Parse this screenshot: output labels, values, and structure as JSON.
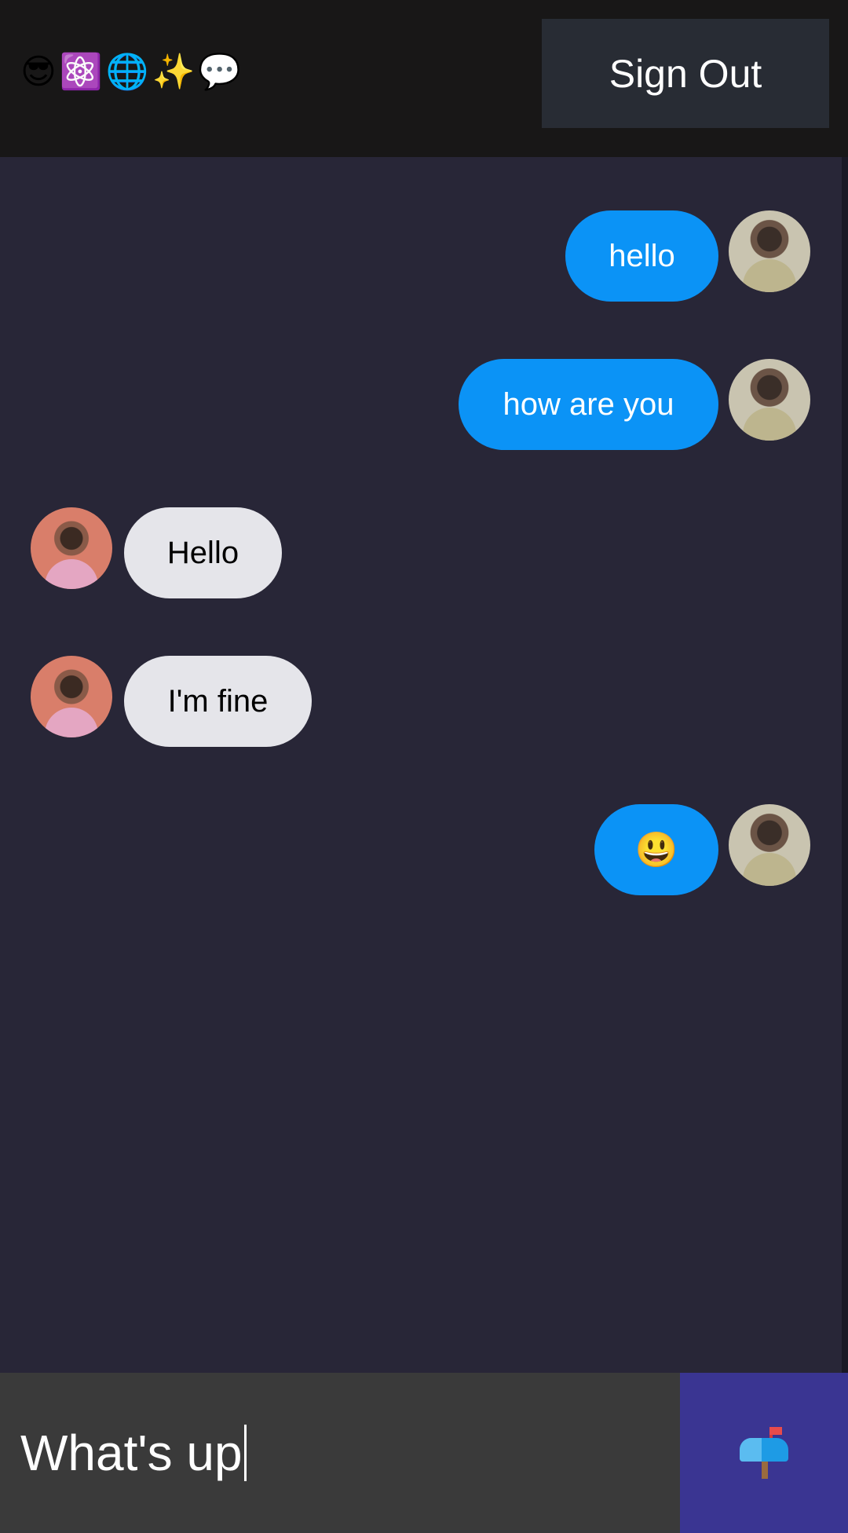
{
  "header": {
    "logo_emojis": [
      "😎",
      "⚛️",
      "🌐",
      "✨",
      "💬"
    ],
    "signout_label": "Sign Out"
  },
  "messages": [
    {
      "side": "sent",
      "text": "hello",
      "avatar": "user-avatar"
    },
    {
      "side": "sent",
      "text": "how are you",
      "avatar": "user-avatar"
    },
    {
      "side": "received",
      "text": "Hello",
      "avatar": "friend-avatar"
    },
    {
      "side": "received",
      "text": "I'm fine",
      "avatar": "friend-avatar"
    },
    {
      "side": "sent",
      "text": "😃",
      "avatar": "user-avatar"
    }
  ],
  "composer": {
    "value": "What's up",
    "send_icon": "mailbox-icon"
  },
  "colors": {
    "sent_bubble": "#0b93f6",
    "received_bubble": "#e5e5ea",
    "background": "#282637",
    "header": "#181717",
    "send_button": "#3a3592"
  }
}
